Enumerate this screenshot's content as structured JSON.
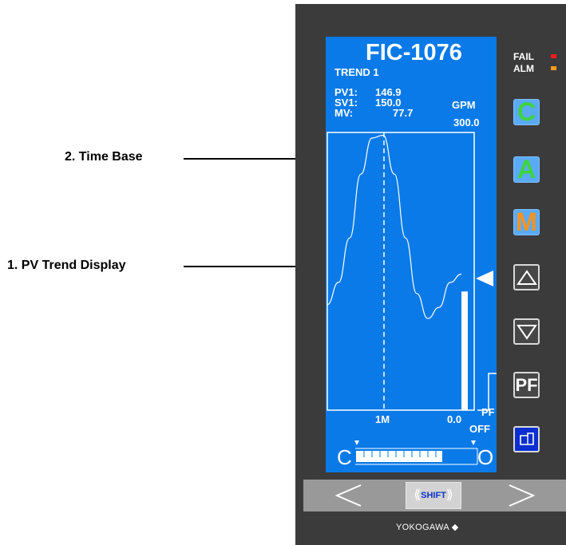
{
  "annotations": {
    "time_base": "2.  Time Base",
    "pv_trend": "1.  PV Trend Display"
  },
  "screen": {
    "tag": "FIC-1076",
    "trend_label": "TREND  1",
    "pv1_label": "PV1:",
    "pv1_value": "146.9",
    "sv1_label": "SV1:",
    "sv1_value": "150.0",
    "mv_label": "MV:",
    "mv_value": "77.7",
    "unit": "GPM",
    "scale_high": "300.0",
    "time_base_label": "1M",
    "scale_low": "0.0",
    "pf_label": "PF",
    "pf_state": "OFF",
    "valve_closed": "C",
    "valve_open": "O"
  },
  "status": {
    "fail_label": "FAIL",
    "alm_label": "ALM",
    "fail_color": "#ff1a1a",
    "alm_color": "#ff9a1a"
  },
  "buttons": {
    "cascade": "C",
    "auto": "A",
    "manual": "M",
    "pf": "PF",
    "cascade_color": "#3ed43e",
    "auto_color": "#3ed43e",
    "manual_color": "#f7931e"
  },
  "bottom": {
    "shift_label": "SHIFT",
    "brand": "YOKOGAWA ◆"
  },
  "trend_data": {
    "pv_normalized": [
      0.38,
      0.46,
      0.62,
      0.85,
      0.98,
      0.99,
      0.85,
      0.62,
      0.42,
      0.33,
      0.37,
      0.46,
      0.49
    ],
    "mv_percent": 77.7,
    "sv_percent": 50
  }
}
